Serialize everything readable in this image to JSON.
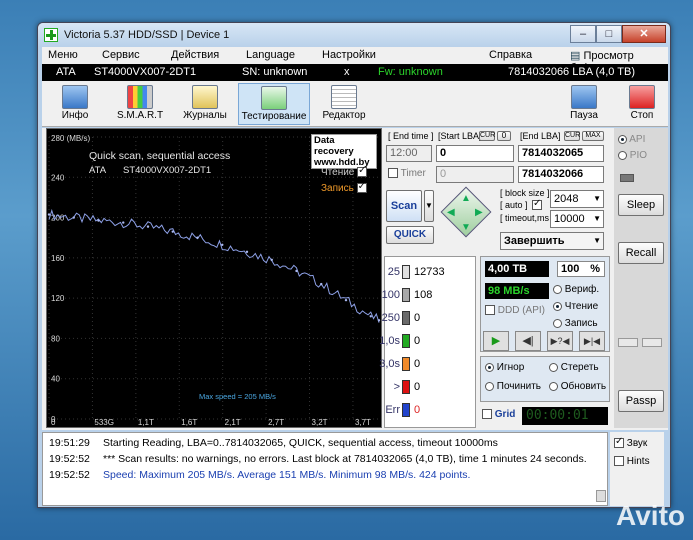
{
  "window": {
    "title": "Victoria 5.37 HDD/SSD | Device 1",
    "controls": [
      "–",
      "□",
      "✕"
    ]
  },
  "menu": {
    "items": [
      "Меню",
      "Сервис",
      "Действия",
      "Language",
      "Настройки",
      "Справка"
    ],
    "buffer_view": "Просмотр буфера"
  },
  "info": {
    "iface": "ATA",
    "model": "ST4000VX007-2DT1",
    "serial": "SN: unknown",
    "x": "x",
    "firmware": "Fw: unknown",
    "lba": "7814032066 LBA (4,0 TB)"
  },
  "toolbar": {
    "info": "Инфо",
    "smart": "S.M.A.R.T",
    "logs": "Журналы",
    "test": "Тестирование",
    "editor": "Редактор",
    "pause": "Пауза",
    "stop": "Стоп"
  },
  "graph": {
    "unit": "280 (MB/s)",
    "title": "Quick scan, sequential access",
    "subtitle_iface": "ATA",
    "subtitle_model": "ST4000VX007-2DT1",
    "recovery_line1": "Data recovery",
    "recovery_line2": "www.hdd.by",
    "read_label": "Чтение",
    "write_label": "Запись",
    "max_speed": "Max speed = 205 MB/s"
  },
  "chart_data": {
    "type": "line",
    "title": "Quick scan, sequential access",
    "ylabel": "(MB/s)",
    "ylim": [
      0,
      280
    ],
    "y_ticks": [
      "280 (MB/s)",
      "240",
      "200",
      "160",
      "120",
      "80",
      "40",
      "0"
    ],
    "x_ticks": [
      "0",
      "533G",
      "1,1T",
      "1,6T",
      "2,1T",
      "2,7T",
      "3,2T",
      "3,7T"
    ],
    "series": [
      {
        "name": "Чтение",
        "x": [
          0,
          0.3,
          0.6,
          0.9,
          1.2,
          1.5,
          1.8,
          2.1,
          2.4,
          2.7,
          3.0,
          3.3,
          3.6,
          3.9,
          4.0
        ],
        "values": [
          203,
          200,
          197,
          195,
          191,
          186,
          180,
          173,
          166,
          158,
          147,
          134,
          118,
          102,
          98
        ]
      }
    ]
  },
  "scan": {
    "end_time_label": "[ End time ]",
    "start_lba_label": "[Start LBA]",
    "cur_label": "CUR",
    "zero": "0",
    "end_lba_label": "[End LBA]",
    "max_label": "MAX",
    "end_time_value": "12:00",
    "start_lba": "0",
    "end_lba": "7814032065",
    "end_lba2": "7814032066",
    "timer_label": "Timer",
    "timer_value": "0",
    "block_size_label": "[ block size ]",
    "auto_label": "[ auto ]",
    "timeout_label": "[ timeout,ms ]",
    "block_size": "2048",
    "timeout": "10000",
    "scan_btn": "Scan",
    "quick_btn": "QUICK",
    "finish": "Завершить"
  },
  "stats": [
    {
      "label": "25",
      "count": "12733",
      "color": "#e0e0e0"
    },
    {
      "label": "100",
      "count": "108",
      "color": "#a8a8a8"
    },
    {
      "label": "250",
      "count": "0",
      "color": "#6a6a6a"
    },
    {
      "label": "1,0s",
      "count": "0",
      "color": "#22aa22"
    },
    {
      "label": "3,0s",
      "count": "0",
      "color": "#f08a2a"
    },
    {
      "label": ">",
      "count": "0",
      "color": "#dd1111"
    },
    {
      "label": "Err",
      "count": "0",
      "color": "#2244cc"
    }
  ],
  "progress": {
    "size": "4,00 TB",
    "percent": "100",
    "pct_sign": "%",
    "speed": "98 MB/s",
    "verify": "Вериф.",
    "read": "Чтение",
    "write": "Запись",
    "ddd": "DDD (API)"
  },
  "actions": {
    "ignore": "Игнор",
    "erase": "Стереть",
    "repair": "Починить",
    "refresh": "Обновить",
    "grid": "Grid",
    "clock": "00:00:01"
  },
  "side": {
    "api": "API",
    "pio": "PIO",
    "sleep": "Sleep",
    "recall": "Recall",
    "passp": "Passp",
    "sound": "Звук",
    "hints": "Hints"
  },
  "log": [
    {
      "time": "19:51:29",
      "text": "Starting Reading, LBA=0..7814032065, QUICK, sequential access, timeout 10000ms",
      "color": "#000000"
    },
    {
      "time": "19:52:52",
      "text": "*** Scan results: no warnings, no errors. Last block at 7814032065 (4,0 TB), time 1 minutes 24 seconds.",
      "color": "#000000"
    },
    {
      "time": "19:52:52",
      "text": "Speed: Maximum 205 MB/s. Average 151 MB/s. Minimum 98 MB/s. 424 points.",
      "color": "#1a3fb0"
    }
  ],
  "watermark": "Avito"
}
